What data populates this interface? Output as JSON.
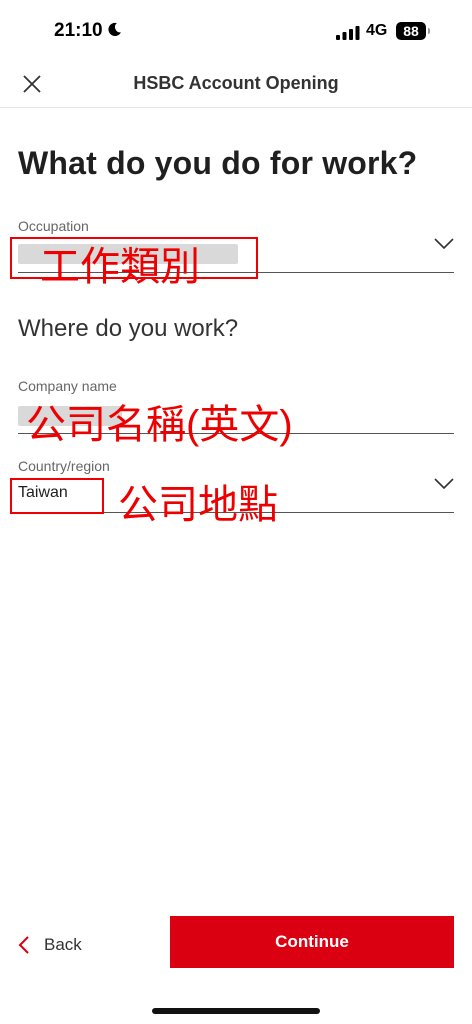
{
  "status_bar": {
    "time": "21:10",
    "network": "4G",
    "battery": "88"
  },
  "header": {
    "title": "HSBC Account Opening"
  },
  "page": {
    "heading": "What do you do for work?",
    "section_heading": "Where do you work?"
  },
  "fields": {
    "occupation": {
      "label": "Occupation",
      "annotation": "工作類別"
    },
    "company_name": {
      "label": "Company name",
      "annotation": "公司名稱(英文)"
    },
    "country": {
      "label": "Country/region",
      "value": "Taiwan",
      "annotation": "公司地點"
    }
  },
  "footer": {
    "back_label": "Back",
    "continue_label": "Continue"
  },
  "colors": {
    "brand_red": "#db0011",
    "annotation_red": "#ee0000"
  }
}
